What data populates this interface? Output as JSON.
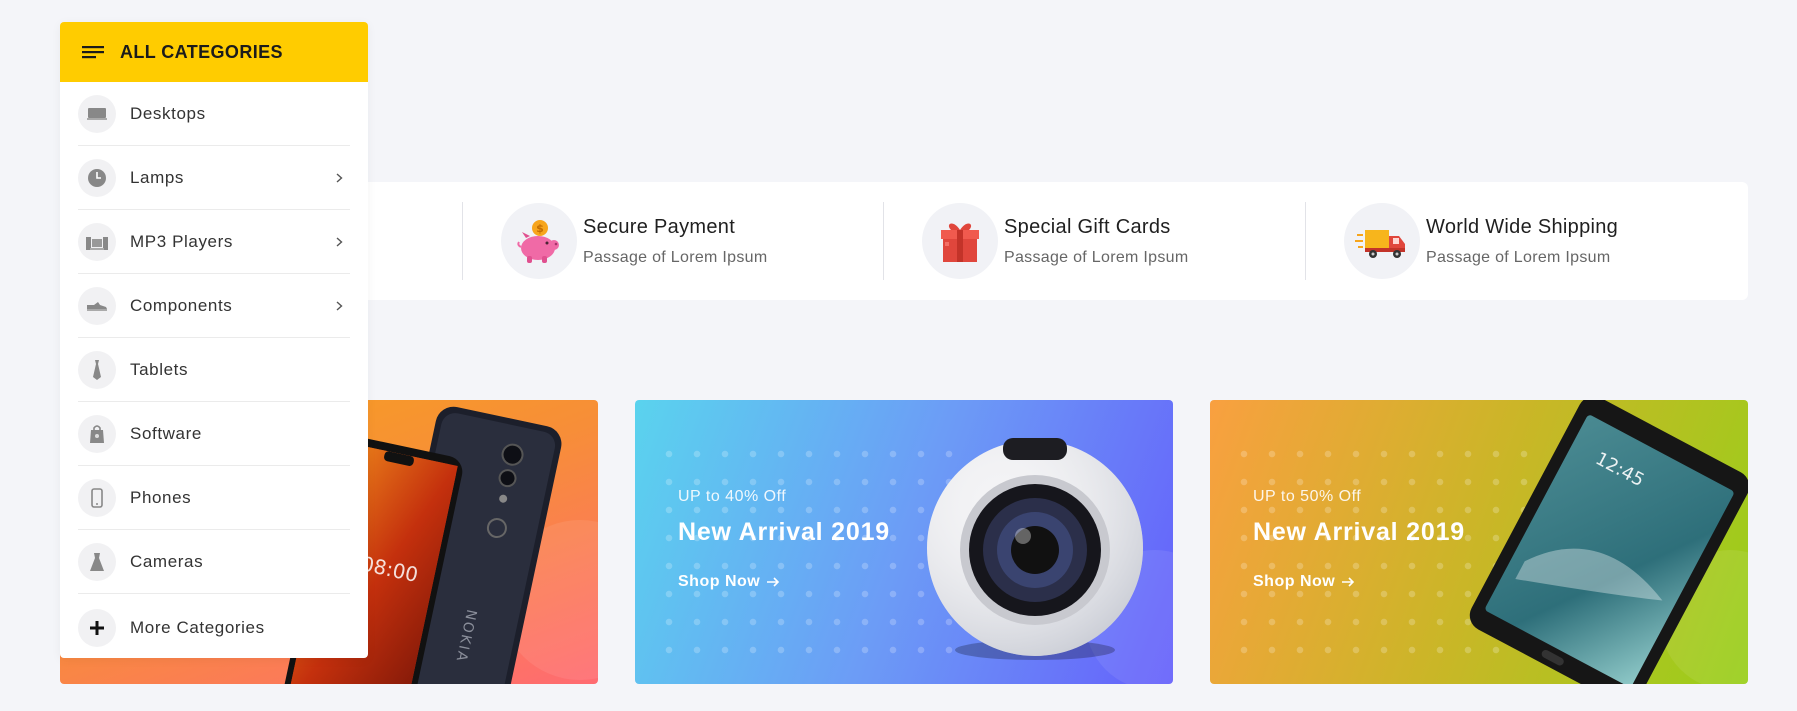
{
  "categories": {
    "header_title": "ALL CATEGORIES",
    "items": [
      {
        "label": "Desktops",
        "icon": "desktop-icon",
        "has_submenu": false
      },
      {
        "label": "Lamps",
        "icon": "clock-icon",
        "has_submenu": true
      },
      {
        "label": "MP3 Players",
        "icon": "speaker-icon",
        "has_submenu": true
      },
      {
        "label": "Components",
        "icon": "shoe-icon",
        "has_submenu": true
      },
      {
        "label": "Tablets",
        "icon": "tie-icon",
        "has_submenu": false
      },
      {
        "label": "Software",
        "icon": "bag-icon",
        "has_submenu": false
      },
      {
        "label": "Phones",
        "icon": "phone-icon",
        "has_submenu": false
      },
      {
        "label": "Cameras",
        "icon": "dress-icon",
        "has_submenu": false
      }
    ],
    "more_label": "More Categories"
  },
  "features": [
    {
      "title": "Secure Payment",
      "subtitle": "Passage of Lorem Ipsum",
      "icon": "piggy-bank-icon"
    },
    {
      "title": "Special Gift Cards",
      "subtitle": "Passage of Lorem Ipsum",
      "icon": "gift-icon"
    },
    {
      "title": "World Wide Shipping",
      "subtitle": "Passage of Lorem Ipsum",
      "icon": "truck-icon"
    }
  ],
  "banners": [
    {
      "product": "smartphone"
    },
    {
      "promo": "UP to 40% Off",
      "headline": "New Arrival 2019",
      "cta": "Shop Now",
      "product": "camera"
    },
    {
      "promo": "UP to 50% Off",
      "headline": "New Arrival 2019",
      "cta": "Shop Now",
      "product": "tablet"
    }
  ],
  "colors": {
    "accent": "#ffcc00",
    "background": "#f4f5f9"
  }
}
